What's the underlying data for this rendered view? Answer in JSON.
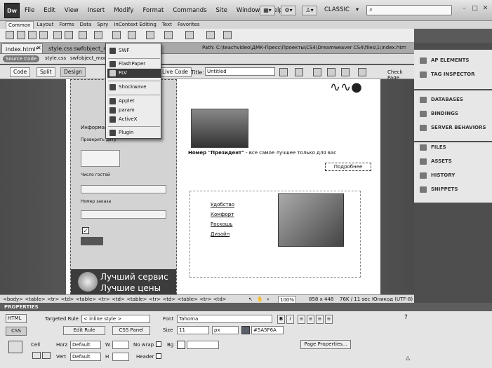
{
  "app": {
    "logo": "Dw",
    "workspace": "CLASSIC",
    "search_placeholder": ""
  },
  "menu": [
    "File",
    "Edit",
    "View",
    "Insert",
    "Modify",
    "Format",
    "Commands",
    "Site",
    "Window",
    "Help"
  ],
  "insert_tabs": [
    "Common",
    "Layout",
    "Forms",
    "Data",
    "Spry",
    "InContext Editing",
    "Text",
    "Favorites"
  ],
  "doc": {
    "tabs": [
      "index.html*",
      "style.css",
      "swfobject_moc"
    ],
    "path": "Path: C:\\teachvideo\\ДМК-Пресс\\Проекты\\CS4\\Dreamweaver CS4\\files\\1\\index.html",
    "related": [
      "Source Code",
      "style.css",
      "swfobject_moc"
    ]
  },
  "viewbar": {
    "code": "Code",
    "split": "Split",
    "design": "Design",
    "live_code": "Live Code",
    "title_label": "Title:",
    "title_value": "Untitled",
    "check_page": "Check Page"
  },
  "media_menu": {
    "items": [
      "SWF",
      "FlashPaper",
      "FLV",
      "Shockwave",
      "Applet",
      "param",
      "ActiveX",
      "Plugin"
    ],
    "selected": "FLV"
  },
  "page": {
    "form_labels": [
      "Информация",
      "Проверить дату",
      "Число гостей",
      "Номер заказа"
    ],
    "banner": [
      "Лучший сервис",
      "Лучшие цены"
    ],
    "hotel_title": "Номер \"Президент\"",
    "hotel_desc": " - все самое лучшее только для вас",
    "more": "Подробнее",
    "features": [
      "Удобство",
      "Комфорт",
      "Роскошь",
      "Дизайн"
    ]
  },
  "status": {
    "tags": "<body> <table> <tr> <td> <table> <tr> <td> <table> <tr> <td> <table> <tr> <td>",
    "zoom": "100%",
    "size": "858 x 448",
    "weight": "76K / 11 sec",
    "encoding": "Юникод (UTF-8)"
  },
  "properties": {
    "title": "PROPERTIES",
    "html": "HTML",
    "css": "CSS",
    "targeted_rule_label": "Targeted Rule",
    "targeted_rule": "< inline style >",
    "font_label": "Font",
    "font": "Tahoma",
    "edit_rule": "Edit Rule",
    "css_panel": "CSS Panel",
    "size_label": "Size",
    "size": "11",
    "unit": "px",
    "color": "#5A5F6A",
    "cell_label": "Cell",
    "horz_label": "Horz",
    "horz": "Default",
    "vert_label": "Vert",
    "vert": "Default",
    "w_label": "W",
    "h_label": "H",
    "nowrap": "No wrap",
    "bg": "Bg",
    "header": "Header",
    "page_props": "Page Properties..."
  },
  "panels": {
    "g1": [
      "AP ELEMENTS",
      "TAG INSPECTOR"
    ],
    "g2": [
      "DATABASES",
      "BINDINGS",
      "SERVER BEHAVIORS"
    ],
    "g3": [
      "FILES",
      "ASSETS",
      "HISTORY",
      "SNIPPETS"
    ]
  }
}
